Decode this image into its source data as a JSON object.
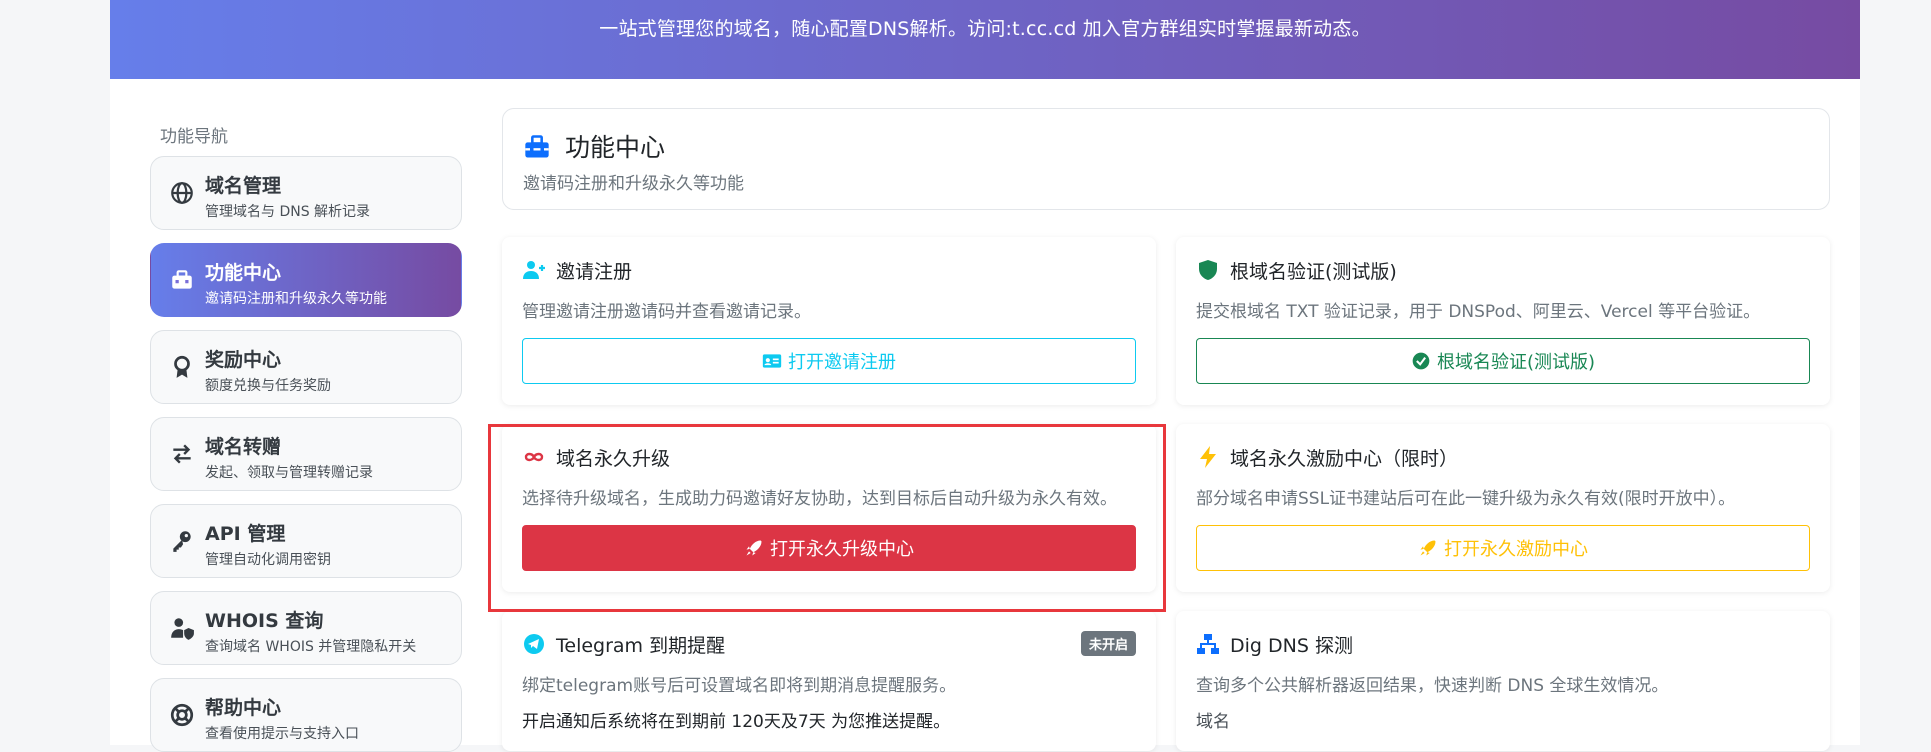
{
  "hero": {
    "text": "一站式管理您的域名，随心配置DNS解析。访问:t.cc.cd 加入官方群组实时掌握最新动态。"
  },
  "sidebar": {
    "heading": "功能导航",
    "items": [
      {
        "title": "域名管理",
        "sub": "管理域名与 DNS 解析记录",
        "icon": "globe-icon",
        "active": false
      },
      {
        "title": "功能中心",
        "sub": "邀请码注册和升级永久等功能",
        "icon": "toolbox-icon",
        "active": true
      },
      {
        "title": "奖励中心",
        "sub": "额度兑换与任务奖励",
        "icon": "award-icon",
        "active": false
      },
      {
        "title": "域名转赠",
        "sub": "发起、领取与管理转赠记录",
        "icon": "exchange-icon",
        "active": false
      },
      {
        "title": "API 管理",
        "sub": "管理自动化调用密钥",
        "icon": "key-icon",
        "active": false
      },
      {
        "title": "WHOIS 查询",
        "sub": "查询域名 WHOIS 并管理隐私开关",
        "icon": "user-shield-icon",
        "active": false
      },
      {
        "title": "帮助中心",
        "sub": "查看使用提示与支持入口",
        "icon": "lifebuoy-icon",
        "active": false
      }
    ]
  },
  "main": {
    "title": "功能中心",
    "subtitle": "邀请码注册和升级永久等功能",
    "cards": {
      "invite": {
        "title": "邀请注册",
        "desc": "管理邀请注册邀请码并查看邀请记录。",
        "button": "打开邀请注册"
      },
      "root_verify": {
        "title": "根域名验证(测试版)",
        "desc": "提交根域名 TXT 验证记录，用于 DNSPod、阿里云、Vercel 等平台验证。",
        "button": "根域名验证(测试版)"
      },
      "upgrade": {
        "title": "域名永久升级",
        "desc": "选择待升级域名，生成助力码邀请好友协助，达到目标后自动升级为永久有效。",
        "button": "打开永久升级中心"
      },
      "incentive": {
        "title": "域名永久激励中心（限时）",
        "desc": "部分域名申请SSL证书建站后可在此一键升级为永久有效(限时开放中）。",
        "button": "打开永久激励中心"
      },
      "telegram": {
        "title": "Telegram 到期提醒",
        "badge": "未开启",
        "desc": "绑定telegram账号后可设置域名即将到期消息提醒服务。",
        "note": "开启通知后系统将在到期前 120天及7天 为您推送提醒。"
      },
      "dig": {
        "title": "Dig DNS 探测",
        "desc": "查询多个公共解析器返回结果，快速判断 DNS 全球生效情况。",
        "field_label": "域名"
      }
    }
  },
  "colors": {
    "hero_start": "#667eea",
    "hero_end": "#764ba2",
    "info": "#0dcaf0",
    "success": "#198754",
    "danger": "#dc3545",
    "warning": "#ffc107",
    "highlight": "#e8373c"
  }
}
